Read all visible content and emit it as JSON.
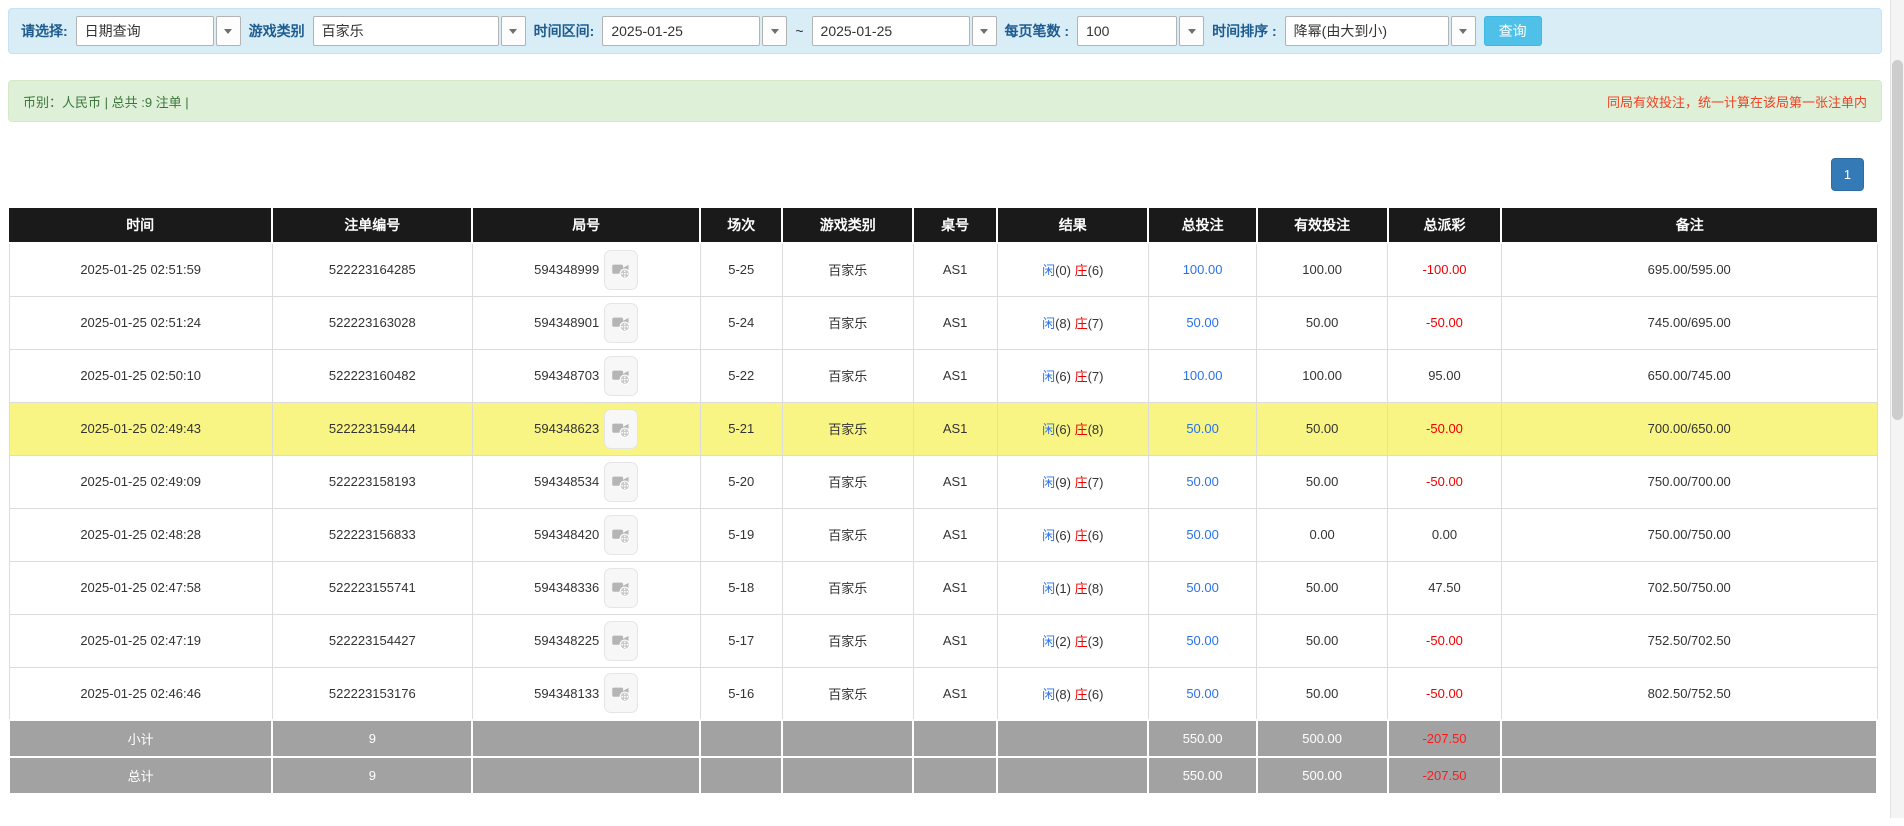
{
  "filters": {
    "select_label": "请选择:",
    "select_value": "日期查询",
    "game_type_label": "游戏类别",
    "game_type_value": "百家乐",
    "date_range_label": "时间区间:",
    "date_from": "2025-01-25",
    "range_separator": "~",
    "date_to": "2025-01-25",
    "page_size_label": "每页笔数 :",
    "page_size_value": "100",
    "sort_label": "时间排序 :",
    "sort_value": "降幂(由大到小)",
    "search_button": "查询"
  },
  "summary_bar": {
    "left_text": "币别：人民币 | 总共 :9 注单 |",
    "right_text": "同局有效投注，统一计算在该局第一张注单内"
  },
  "pagination": {
    "page": "1"
  },
  "colors": {
    "filter_bar_bg": "#d9edf7",
    "label_text": "#1e5c90",
    "search_button_bg": "#4fc1e9",
    "summary_bg": "#dff0d8",
    "summary_text": "#3c763d",
    "warning_text": "#f04124",
    "pagination_bg": "#337ab7",
    "header_bg": "#1a1a1a",
    "highlight_row_bg": "#f8f584",
    "player_blue": "#2b72e8",
    "banker_red": "#ee0000",
    "negative_red": "#ee0000",
    "footer_bg": "#a2a2a2"
  },
  "table": {
    "headers": [
      "时间",
      "注单编号",
      "局号",
      "场次",
      "游戏类别",
      "桌号",
      "结果",
      "总投注",
      "有效投注",
      "总派彩",
      "备注"
    ],
    "rows": [
      {
        "time": "2025-01-25 02:51:59",
        "bet_id": "522223164285",
        "round_id": "594348999",
        "session": "5-25",
        "game": "百家乐",
        "table_no": "AS1",
        "result": {
          "player": "闲",
          "player_pts": "(0)",
          "banker": "庄",
          "banker_pts": "(6)"
        },
        "total_bet": "100.00",
        "valid_bet": "100.00",
        "payout": "-100.00",
        "remark": "695.00/595.00",
        "highlight": false
      },
      {
        "time": "2025-01-25 02:51:24",
        "bet_id": "522223163028",
        "round_id": "594348901",
        "session": "5-24",
        "game": "百家乐",
        "table_no": "AS1",
        "result": {
          "player": "闲",
          "player_pts": "(8)",
          "banker": "庄",
          "banker_pts": "(7)"
        },
        "total_bet": "50.00",
        "valid_bet": "50.00",
        "payout": "-50.00",
        "remark": "745.00/695.00",
        "highlight": false
      },
      {
        "time": "2025-01-25 02:50:10",
        "bet_id": "522223160482",
        "round_id": "594348703",
        "session": "5-22",
        "game": "百家乐",
        "table_no": "AS1",
        "result": {
          "player": "闲",
          "player_pts": "(6)",
          "banker": "庄",
          "banker_pts": "(7)"
        },
        "total_bet": "100.00",
        "valid_bet": "100.00",
        "payout": "95.00",
        "remark": "650.00/745.00",
        "highlight": false
      },
      {
        "time": "2025-01-25 02:49:43",
        "bet_id": "522223159444",
        "round_id": "594348623",
        "session": "5-21",
        "game": "百家乐",
        "table_no": "AS1",
        "result": {
          "player": "闲",
          "player_pts": "(6)",
          "banker": "庄",
          "banker_pts": "(8)"
        },
        "total_bet": "50.00",
        "valid_bet": "50.00",
        "payout": "-50.00",
        "remark": "700.00/650.00",
        "highlight": true
      },
      {
        "time": "2025-01-25 02:49:09",
        "bet_id": "522223158193",
        "round_id": "594348534",
        "session": "5-20",
        "game": "百家乐",
        "table_no": "AS1",
        "result": {
          "player": "闲",
          "player_pts": "(9)",
          "banker": "庄",
          "banker_pts": "(7)"
        },
        "total_bet": "50.00",
        "valid_bet": "50.00",
        "payout": "-50.00",
        "remark": "750.00/700.00",
        "highlight": false
      },
      {
        "time": "2025-01-25 02:48:28",
        "bet_id": "522223156833",
        "round_id": "594348420",
        "session": "5-19",
        "game": "百家乐",
        "table_no": "AS1",
        "result": {
          "player": "闲",
          "player_pts": "(6)",
          "banker": "庄",
          "banker_pts": "(6)"
        },
        "total_bet": "50.00",
        "valid_bet": "0.00",
        "payout": "0.00",
        "remark": "750.00/750.00",
        "highlight": false
      },
      {
        "time": "2025-01-25 02:47:58",
        "bet_id": "522223155741",
        "round_id": "594348336",
        "session": "5-18",
        "game": "百家乐",
        "table_no": "AS1",
        "result": {
          "player": "闲",
          "player_pts": "(1)",
          "banker": "庄",
          "banker_pts": "(8)"
        },
        "total_bet": "50.00",
        "valid_bet": "50.00",
        "payout": "47.50",
        "remark": "702.50/750.00",
        "highlight": false
      },
      {
        "time": "2025-01-25 02:47:19",
        "bet_id": "522223154427",
        "round_id": "594348225",
        "session": "5-17",
        "game": "百家乐",
        "table_no": "AS1",
        "result": {
          "player": "闲",
          "player_pts": "(2)",
          "banker": "庄",
          "banker_pts": "(3)"
        },
        "total_bet": "50.00",
        "valid_bet": "50.00",
        "payout": "-50.00",
        "remark": "752.50/702.50",
        "highlight": false
      },
      {
        "time": "2025-01-25 02:46:46",
        "bet_id": "522223153176",
        "round_id": "594348133",
        "session": "5-16",
        "game": "百家乐",
        "table_no": "AS1",
        "result": {
          "player": "闲",
          "player_pts": "(8)",
          "banker": "庄",
          "banker_pts": "(6)"
        },
        "total_bet": "50.00",
        "valid_bet": "50.00",
        "payout": "-50.00",
        "remark": "802.50/752.50",
        "highlight": false
      }
    ],
    "subtotal": {
      "label": "小计",
      "count": "9",
      "total_bet": "550.00",
      "valid_bet": "500.00",
      "payout": "-207.50"
    },
    "total": {
      "label": "总计",
      "count": "9",
      "total_bet": "550.00",
      "valid_bet": "500.00",
      "payout": "-207.50"
    }
  }
}
